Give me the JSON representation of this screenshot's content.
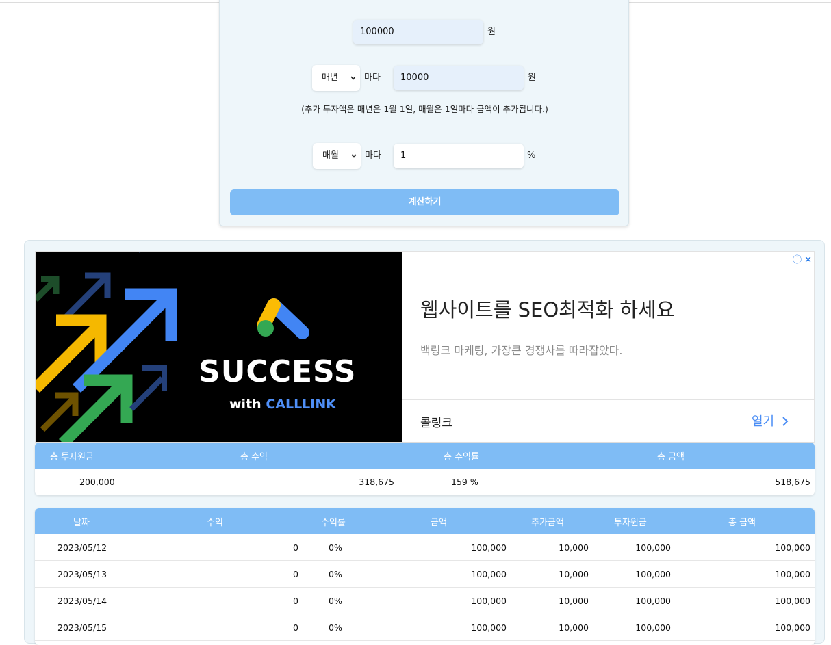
{
  "form": {
    "principal_value": "100000",
    "won_unit": "원",
    "add_frequency": "매년",
    "every_label": "마다",
    "add_amount_value": "10000",
    "note": "(추가 투자액은 매년은 1월 1일, 매월은 1일마다 금액이 추가됩니다.)",
    "rate_frequency": "매월",
    "rate_value": "1",
    "percent_unit": "%",
    "calc_button": "계산하기"
  },
  "ad": {
    "image_headline": "SUCCESS",
    "image_with": "with",
    "image_brand": "CALLLINK",
    "title": "웹사이트를 SEO최적화 하세요",
    "description": "백링크 마케팅, 가장큰 경쟁사를 따라잡았다.",
    "advertiser": "콜링크",
    "open_label": "열기",
    "corner": "ⓘ ✕"
  },
  "summary": {
    "headers": [
      "총 투자원금",
      "총 수익",
      "총 수익률",
      "총 금액"
    ],
    "row": [
      "200,000",
      "318,675",
      "159 %",
      "518,675"
    ]
  },
  "detail": {
    "headers": [
      "날짜",
      "수익",
      "수익률",
      "금액",
      "추가금액",
      "투자원금",
      "총 금액"
    ],
    "rows": [
      [
        "2023/05/12",
        "0",
        "0%",
        "100,000",
        "10,000",
        "100,000",
        "100,000"
      ],
      [
        "2023/05/13",
        "0",
        "0%",
        "100,000",
        "10,000",
        "100,000",
        "100,000"
      ],
      [
        "2023/05/14",
        "0",
        "0%",
        "100,000",
        "10,000",
        "100,000",
        "100,000"
      ],
      [
        "2023/05/15",
        "0",
        "0%",
        "100,000",
        "10,000",
        "100,000",
        "100,000"
      ]
    ]
  },
  "colors": {
    "accent": "#7fbcf5",
    "panel": "#eef6fa",
    "input": "#e6f0fb",
    "link": "#4a8df5"
  }
}
